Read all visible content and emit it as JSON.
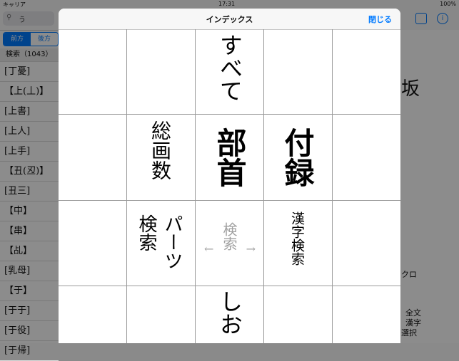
{
  "status": {
    "carrier": "キャリア",
    "time": "17:31",
    "battery": "100%"
  },
  "search": {
    "icon": "search-icon",
    "value": "う"
  },
  "mode_tabs": [
    "前方",
    "後方"
  ],
  "sidebar": {
    "count_label": "検索（1043）",
    "items": [
      "[丁憂]",
      "【上(丄)】",
      "[上書]",
      "[上人]",
      "[上手]",
      "【丑(丒)】",
      "[丑三]",
      "【中】",
      "【串】",
      "【乩】",
      "[乳母]",
      "【于】",
      "[于于]",
      "[于役]",
      "[于帰]"
    ]
  },
  "right_pane": {
    "big_char": "坂",
    "label1": "クロ",
    "label2": "全文",
    "label3": "漢字",
    "label4": "選択"
  },
  "modal": {
    "title": "インデックス",
    "close": "閉じる",
    "cells": {
      "all": "すべて",
      "stroke_count": "総画数",
      "radical": "部首",
      "appendix": "付録",
      "parts_search_1": "パーツ",
      "parts_search_2": "検索",
      "search_center": "検索",
      "arrows": "←→",
      "kanji_search": "漢字検索",
      "bookmark": "しお"
    }
  },
  "colors": {
    "accent": "#007aff",
    "grid": "#9a9a9a",
    "disabled_text": "#a0a0a0"
  }
}
